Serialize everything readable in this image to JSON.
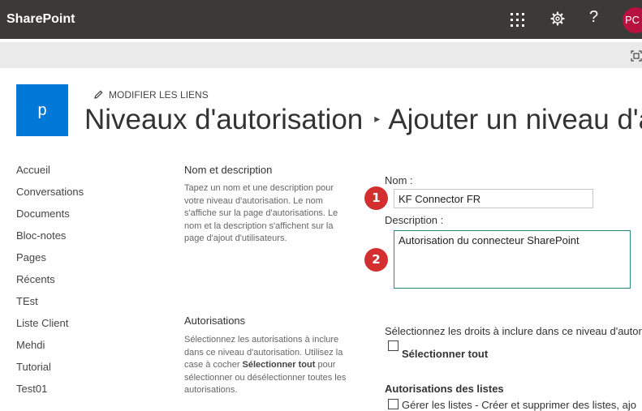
{
  "suite_bar": {
    "brand": "SharePoint",
    "avatar_initials": "PC",
    "help_glyph": "?",
    "icons": [
      "app-launcher-icon",
      "gear-icon",
      "help-icon"
    ],
    "colors": {
      "bar": "#3b3a39",
      "avatar": "#b7113f"
    }
  },
  "site": {
    "logo_letter": "p",
    "logo_color": "#0078d7",
    "edit_links_label": "MODIFIER LES LIENS",
    "breadcrumb": {
      "parent": "Niveaux d'autorisation",
      "separator": "▸",
      "current": "Ajouter un niveau d'a"
    }
  },
  "left_nav": {
    "items": [
      {
        "label": "Accueil"
      },
      {
        "label": "Conversations"
      },
      {
        "label": "Documents"
      },
      {
        "label": "Bloc-notes"
      },
      {
        "label": "Pages"
      },
      {
        "label": "Récents"
      },
      {
        "label": "TEst"
      },
      {
        "label": "Liste Client"
      },
      {
        "label": "Mehdi"
      },
      {
        "label": "Tutorial"
      },
      {
        "label": "Test01"
      }
    ]
  },
  "name_section": {
    "title": "Nom et description",
    "description": "Tapez un nom et une description pour votre niveau d'autorisation. Le nom s'affiche sur la page d'autorisations. Le nom et la description s'affichent sur la page d'ajout d'utilisateurs.",
    "name_label": "Nom :",
    "name_value": "KF Connector FR",
    "description_label": "Description :",
    "description_value": "Autorisation du connecteur SharePoint",
    "badges": [
      "1",
      "2"
    ],
    "badge_color": "#d32f2f"
  },
  "permissions_section": {
    "title": "Autorisations",
    "description_before": "Sélectionnez les autorisations à inclure dans ce niveau d'autorisation. Utilisez la case à cocher ",
    "description_bold": "Sélectionner tout",
    "description_after": " pour sélectionner ou désélectionner toutes les autorisations.",
    "intro": "Sélectionnez les droits à inclure dans ce niveau d'autori",
    "select_all_label": "Sélectionner tout",
    "select_all_checked": false,
    "list_permissions_title": "Autorisations des listes",
    "manage_lists_label": "Gérer les listes  -  Créer et supprimer des listes, ajo"
  }
}
